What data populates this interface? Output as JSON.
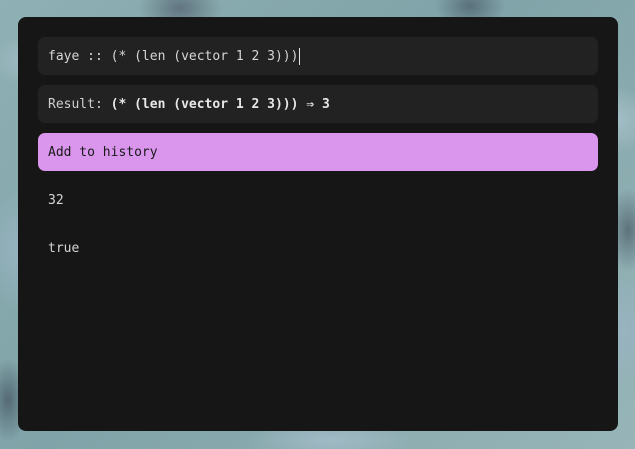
{
  "launcher": {
    "prompt": "faye :: ",
    "query": "(* (len (vector 1 2 3)))",
    "result_label": "Result: ",
    "result_value": "(* (len (vector 1 2 3))) ⇒ 3",
    "items": [
      {
        "label": "Add to history",
        "selected": true
      },
      {
        "label": "32",
        "selected": false
      },
      {
        "label": "true",
        "selected": false
      }
    ]
  },
  "colors": {
    "panel": "#161616",
    "field": "#222222",
    "selected": "#d996ec"
  }
}
